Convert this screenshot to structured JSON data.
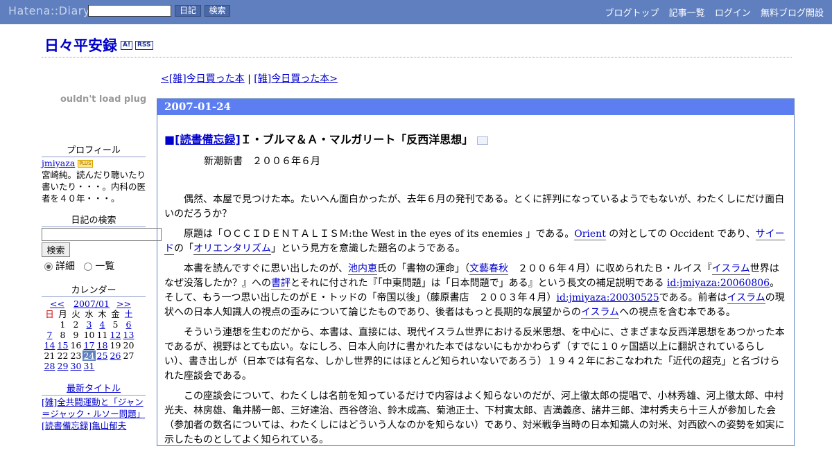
{
  "topbar": {
    "logo": "Hatena::Diary",
    "diary_button": "日記",
    "search_button": "検索",
    "nav": [
      "ブログトップ",
      "記事一覧",
      "ログイン",
      "無料ブログ開設"
    ]
  },
  "header": {
    "title": "日々平安録",
    "badge_a": "A!",
    "badge_rss": "RSS"
  },
  "pager": {
    "prev": "<[雑]今日買った本",
    "sep": " | ",
    "next": "[雑]今日買った本>"
  },
  "sidebar": {
    "plugin_error": "ouldn't load plug",
    "profile_title": "プロフィール",
    "profile_id": "jmiyaza",
    "profile_plus": "PLUS",
    "profile_text": "宮崎純。読んだり聴いたり書いたり・・・。内科の医者を４０年・・・。",
    "search_title": "日記の検索",
    "search_button": "検索",
    "radio_detail": "詳細",
    "radio_list": "一覧",
    "calendar_title": "カレンダー",
    "cal_prev": "<<",
    "cal_month": "2007/01",
    "cal_next": ">>",
    "weekdays": [
      "日",
      "月",
      "火",
      "水",
      "木",
      "金",
      "土"
    ],
    "weeks": [
      [
        "",
        "1",
        "2",
        "3",
        "4",
        "5",
        "6"
      ],
      [
        "7",
        "8",
        "9",
        "10",
        "11",
        "12",
        "13"
      ],
      [
        "14",
        "15",
        "16",
        "17",
        "18",
        "19",
        "20"
      ],
      [
        "21",
        "22",
        "23",
        "24",
        "25",
        "26",
        "27"
      ],
      [
        "28",
        "29",
        "30",
        "31",
        "",
        "",
        ""
      ]
    ],
    "linked_days": [
      "3",
      "4",
      "6",
      "7",
      "12",
      "13",
      "14",
      "15",
      "17",
      "18",
      "24",
      "25",
      "26",
      "28",
      "29",
      "30",
      "31"
    ],
    "today": "24",
    "recent_title": "最新タイトル",
    "recent_text": "[雑]全共闘運動と「ジャン＝ジャック・ルソー問題」",
    "recent_text2": "[読書備忘録]亀山郁夫"
  },
  "main": {
    "date": "2007-01-24",
    "section_mark": "■",
    "category": "[読書備忘録]",
    "title": "Ｉ・ブルマ＆Ａ・マルガリート「反西洋思想」",
    "publisher": "新潮新書　２００６年６月",
    "p1": "偶然、本屋で見つけた本。たいへん面白かったが、去年６月の発刊である。とくに評判になっているようでもないが、わたくしにだけ面白いのだろうか？",
    "p2a": "原題は「ＯＣＣＩＤＥＮＴＡＬＩＳＭ:the West in the eyes of its enemies 」である。",
    "p2b": "Orient",
    "p2c": " の対としての Occident であり、",
    "p2d": "サイード",
    "p2e": "の「",
    "p2f": "オリエンタリズム",
    "p2g": "」という見方を意識した題名のようである。",
    "p3a": "本書を読んですぐに思い出したのが、",
    "p3b": "池内恵",
    "p3c": "氏の「書物の運命」（",
    "p3d": "文藝春秋",
    "p3e": "　２００６年４月）に収められたＢ・ルイス『",
    "p3f": "イスラム",
    "p3g": "世界はなぜ没落したか？』への",
    "p3h": "書評",
    "p3i": "とそれに付された『「中東問題」は「日本問題で」ある』という長文の補足説明である ",
    "p3j": "id:jmiyaza:20060806",
    "p3k": "。そして、もう一つ思い出したのがＥ・トッドの「帝国以後」（藤原書店　２００３年４月）",
    "p3l": "id:jmiyaza:20030525",
    "p3m": "である。前者は",
    "p3n": "イスラム",
    "p3o": "の現状への日本人知識人の視点の歪みについて論じたものであり、後者はもっと長期的な展望からの",
    "p3p": "イスラム",
    "p3q": "への視点を含む本である。",
    "p4": "そういう連想を生むのだから、本書は、直接には、現代イスラム世界における反米思想、を中心に、さまざまな反西洋思想をあつかった本であるが、視野はとても広い。なにしろ、日本人向けに書かれた本ではないにもかかわらず（すでに１０ヶ国語以上に翻訳されているらしい）、書き出しが（日本では有名な、しかし世界的にはほとんど知られいないであろう）１９４２年におこなわれた「近代の超克」と名づけられた座談会である。",
    "p5": "この座談会について、わたくしは名前を知っているだけで内容はよく知らないのだが、河上徹太郎の提唱で、小林秀雄、河上徹太郎、中村光夫、林房雄、亀井勝一郎、三好達治、西谷啓治、鈴木成高、菊池正士、下村寅太郎、吉満義彦、諸井三郎、津村秀夫ら十三人が参加した会（参加者の数名については、わたくしにはどういう人なのかを知らない）であり、対米戦争当時の日本知識人の対米、対西欧への姿勢を如実に示したものとしてよく知られている。"
  }
}
